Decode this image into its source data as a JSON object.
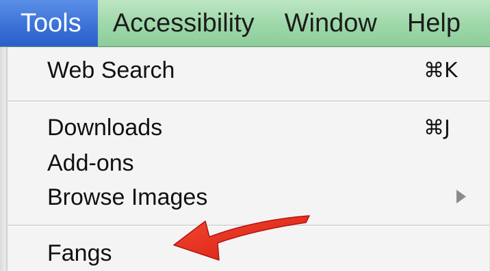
{
  "menubar": {
    "items": [
      {
        "label": "Tools",
        "active": true
      },
      {
        "label": "Accessibility",
        "active": false
      },
      {
        "label": "Window",
        "active": false
      },
      {
        "label": "Help",
        "active": false
      }
    ]
  },
  "dropdown": {
    "items": [
      {
        "label": "Web Search",
        "shortcut": "⌘K"
      },
      {
        "label": "Downloads",
        "shortcut": "⌘J"
      },
      {
        "label": "Add-ons",
        "shortcut": ""
      },
      {
        "label": "Browse Images",
        "shortcut": "",
        "submenu": true
      },
      {
        "label": "Fangs",
        "shortcut": ""
      }
    ]
  },
  "colors": {
    "menubar_green": "#9fd8aa",
    "active_blue": "#3c72d8",
    "annotation_red": "#e8231c"
  },
  "icons": {
    "submenu": "triangle-right-icon",
    "annotation": "red-pointer-arrow-icon"
  }
}
